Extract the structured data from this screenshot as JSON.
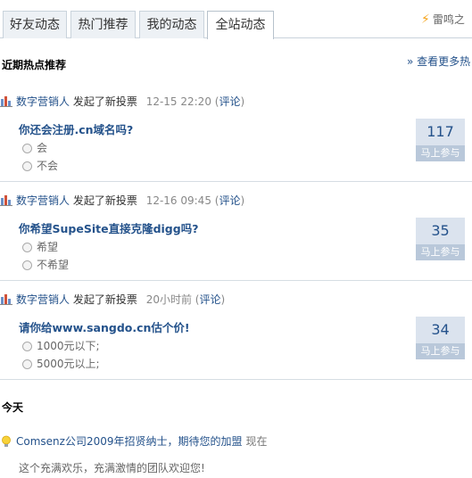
{
  "tabs": [
    {
      "label": "好友动态"
    },
    {
      "label": "热门推荐"
    },
    {
      "label": "我的动态"
    },
    {
      "label": "全站动态"
    }
  ],
  "top_link": "雷鸣之",
  "hot_section": {
    "title": "近期热点推荐",
    "more_label": "» 查看更多热"
  },
  "polls": [
    {
      "user": "数字营销人",
      "action": "发起了新投票",
      "time": "12-15 22:20",
      "paren_open": "(",
      "comment": "评论",
      "paren_close": ")",
      "question": "你还会注册.cn域名吗?",
      "options": [
        "会",
        "不会"
      ],
      "count": "117",
      "join": "马上参与"
    },
    {
      "user": "数字营销人",
      "action": "发起了新投票",
      "time": "12-16 09:45",
      "paren_open": "(",
      "comment": "评论",
      "paren_close": ")",
      "question": "你希望SupeSite直接克隆digg吗?",
      "options": [
        "希望",
        "不希望"
      ],
      "count": "35",
      "join": "马上参与"
    },
    {
      "user": "数字营销人",
      "action": "发起了新投票",
      "time": "20小时前",
      "paren_open": "(",
      "comment": "评论",
      "paren_close": ")",
      "question": "请你给www.sangdo.cn估个价!",
      "options": [
        "1000元以下;",
        "5000元以上;"
      ],
      "count": "34",
      "join": "马上参与"
    }
  ],
  "today_section": {
    "title": "今天"
  },
  "today_item": {
    "link": "Comsenz公司2009年招贤纳士，期待您的加盟",
    "time": "现在",
    "desc": "这个充满欢乐，充满激情的团队欢迎您!"
  },
  "colors": {
    "link": "#24528b",
    "vote_bg": "#dbe3ee",
    "vote_join_bg": "#b9c8da",
    "tab_bg": "#edf1f5"
  },
  "icons": {
    "top_link": "lightning-icon",
    "poll": "bar-chart-icon",
    "today": "lightbulb-icon"
  }
}
